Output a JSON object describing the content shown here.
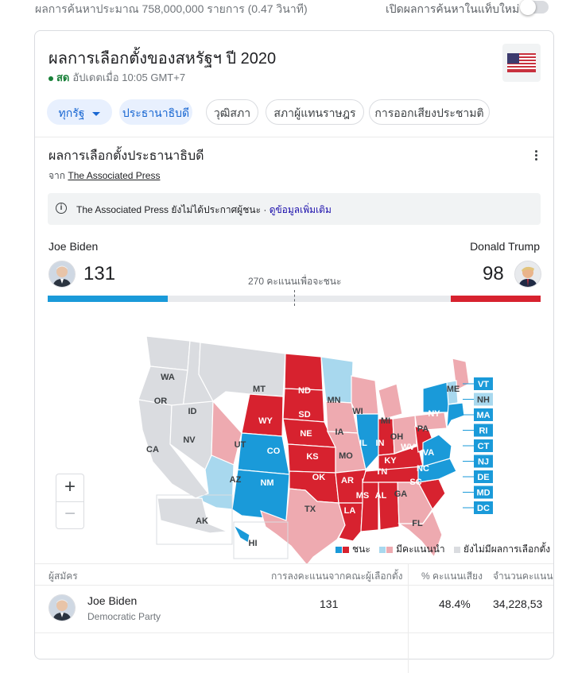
{
  "header": {
    "result_count": "ผลการค้นหาประมาณ 758,000,000 รายการ (0.47 วินาที)",
    "new_tab_label": "เปิดผลการค้นหาในแท็บใหม่"
  },
  "card": {
    "title": "ผลการเลือกตั้งของสหรัฐฯ ปี 2020",
    "live_label": "สด",
    "updated": "อัปเดตเมื่อ 10:05 GMT+7",
    "tabs": [
      {
        "label": "ทุกรัฐ"
      },
      {
        "label": "ประธานาธิบดี"
      },
      {
        "label": "วุฒิสภา"
      },
      {
        "label": "สภาผู้แทนราษฎร"
      },
      {
        "label": "การออกเสียงประชามติ"
      }
    ],
    "section_title": "ผลการเลือกตั้งประธานาธิบดี",
    "source_prefix": "จาก",
    "source_link": "The Associated Press",
    "notice_text": "The Associated Press ยังไม่ได้ประกาศผู้ชนะ ·",
    "notice_link": "ดูข้อมูลเพิ่มเติม"
  },
  "race": {
    "dem_name": "Joe Biden",
    "rep_name": "Donald Trump",
    "dem_votes": "131",
    "rep_votes": "98",
    "to_win": "270 คะแนนเพื่อจะชนะ",
    "dem_fraction": 0.243,
    "rep_fraction": 0.182
  },
  "colors": {
    "dem_win": "#1a9ad9",
    "dem_lead": "#a8d8ee",
    "rep_win": "#d7222f",
    "rep_lead": "#eeaab0",
    "no_result": "#dadce0"
  },
  "map": {
    "state_labels": [
      "WA",
      "OR",
      "CA",
      "ID",
      "NV",
      "MT",
      "WY",
      "UT",
      "AZ",
      "CO",
      "NM",
      "ND",
      "SD",
      "NE",
      "KS",
      "OK",
      "TX",
      "MN",
      "IA",
      "MO",
      "AR",
      "LA",
      "WI",
      "IL",
      "MS",
      "MI",
      "IN",
      "KY",
      "TN",
      "AL",
      "OH",
      "WV",
      "GA",
      "FL",
      "SC",
      "NC",
      "VA",
      "PA",
      "NY",
      "ME",
      "AK",
      "HI"
    ],
    "small_states": [
      "VT",
      "NH",
      "MA",
      "RI",
      "CT",
      "NJ",
      "DE",
      "MD",
      "DC"
    ]
  },
  "legend": {
    "win": "ชนะ",
    "lead": "มีคะแนนนำ",
    "none": "ยังไม่มีผลการเลือกตั้ง"
  },
  "table": {
    "col_candidate": "ผู้สมัคร",
    "col_electoral": "การลงคะแนนจากคณะผู้เลือกตั้ง",
    "col_pct": "% คะแนนเสียง",
    "col_count": "จำนวนคะแนนเสียง",
    "rows": [
      {
        "name": "Joe Biden",
        "party": "Democratic Party",
        "electoral": "131",
        "pct": "48.4%",
        "count": "34,228,53"
      }
    ]
  }
}
